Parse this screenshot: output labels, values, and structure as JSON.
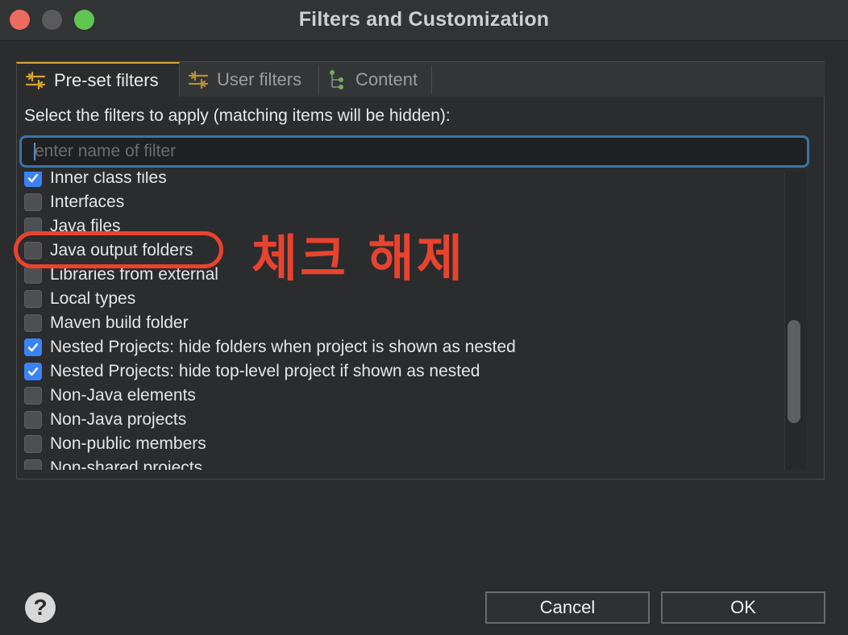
{
  "window": {
    "title": "Filters and Customization"
  },
  "tabs": [
    {
      "label": "Pre-set filters",
      "icon": "filter-sliders-icon"
    },
    {
      "label": "User filters",
      "icon": "filter-sliders-icon"
    },
    {
      "label": "Content",
      "icon": "tree-nodes-icon"
    }
  ],
  "panel": {
    "instruction": "Select the filters to apply (matching items will be hidden):",
    "search_placeholder": "enter name of filter",
    "search_value": ""
  },
  "filters": [
    {
      "label": "Inner class files",
      "checked": true
    },
    {
      "label": "Interfaces",
      "checked": false
    },
    {
      "label": "Java files",
      "checked": false
    },
    {
      "label": "Java output folders",
      "checked": false
    },
    {
      "label": "Libraries from external",
      "checked": false
    },
    {
      "label": "Local types",
      "checked": false
    },
    {
      "label": "Maven build folder",
      "checked": false
    },
    {
      "label": "Nested Projects: hide folders when project is shown as nested",
      "checked": true
    },
    {
      "label": "Nested Projects: hide top-level project if shown as nested",
      "checked": true
    },
    {
      "label": "Non-Java elements",
      "checked": false
    },
    {
      "label": "Non-Java projects",
      "checked": false
    },
    {
      "label": "Non-public members",
      "checked": false
    },
    {
      "label": "Non-shared projects",
      "checked": false
    }
  ],
  "annotation": {
    "text": "체크 해제",
    "color": "#e8432e"
  },
  "buttons": {
    "help": "?",
    "cancel": "Cancel",
    "ok": "OK"
  },
  "colors": {
    "accent": "#3b82f6",
    "tab_active_border": "#d6a431",
    "search_focus": "#3a73a8"
  }
}
